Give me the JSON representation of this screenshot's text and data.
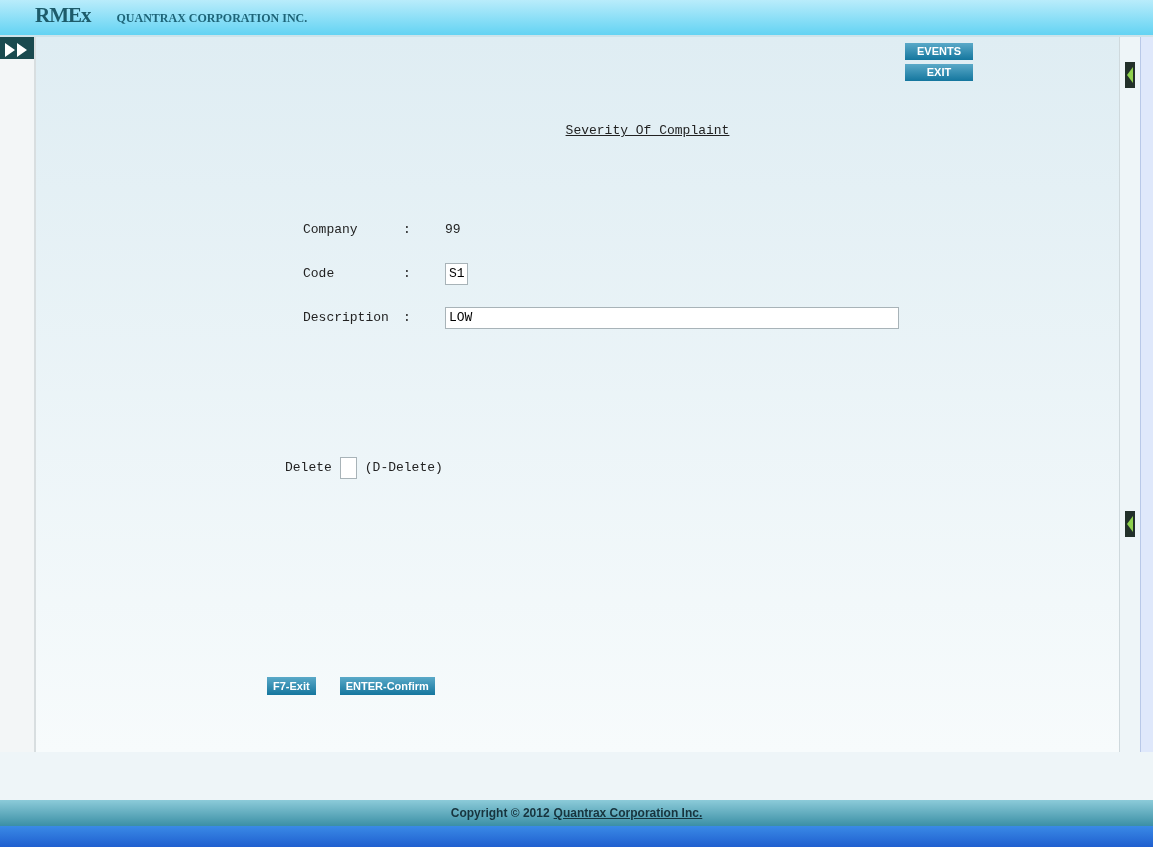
{
  "header": {
    "logo": "RMEx",
    "company": "QUANTRAX CORPORATION INC."
  },
  "top_buttons": [
    "EVENTS",
    "EXIT"
  ],
  "form": {
    "title": "Severity Of Complaint",
    "fields": [
      {
        "kind": "text",
        "label": "Company",
        "separator": ":",
        "value": "99"
      },
      {
        "kind": "code",
        "label": "Code",
        "separator": ":",
        "value": "S1"
      },
      {
        "kind": "input",
        "label": "Description",
        "separator": ":",
        "value": "LOW"
      }
    ],
    "delete": {
      "label": "Delete",
      "hint": "(D-Delete)"
    }
  },
  "bottom_buttons": [
    "F7-Exit",
    "ENTER-Confirm"
  ],
  "footer": {
    "text": "Copyright © 2012",
    "link": "Quantrax Corporation Inc."
  }
}
